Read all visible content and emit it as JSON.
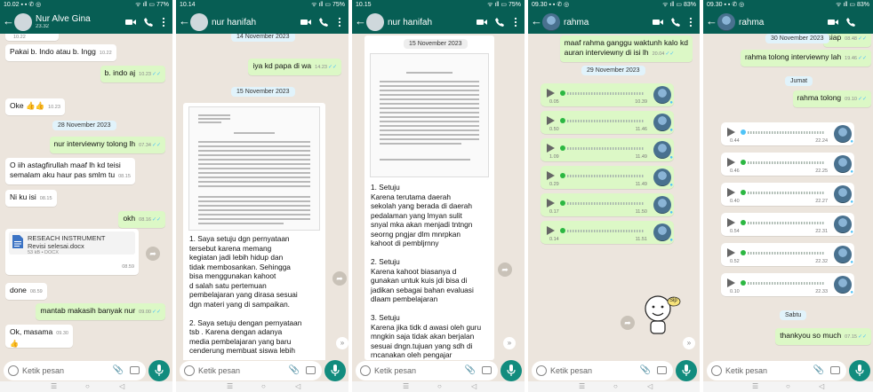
{
  "status_bars": [
    {
      "left": "10.02 ▪ ▪ ✆ ◎",
      "right": "ᯤ ıll ▭ 77%"
    },
    {
      "left": "10.14",
      "right": "ᯤ ıll ▭ 75%"
    },
    {
      "left": "10.15",
      "right": "ᯤ ıll ▭ 75%"
    },
    {
      "left": "09.30 ▪ ▪ ✆ ◎",
      "right": "ᯤ ıll ▭ 83%"
    },
    {
      "left": "09.30 ▪ ▪ ✆ ◎",
      "right": "ᯤ ıll ▭ 83%"
    }
  ],
  "contacts": [
    {
      "name": "Nur Alve Gina",
      "sub": "23.32"
    },
    {
      "name": "nur hanifah",
      "sub": ""
    },
    {
      "name": "nur hanifah",
      "sub": ""
    },
    {
      "name": "rahma",
      "sub": ""
    },
    {
      "name": "rahma",
      "sub": ""
    }
  ],
  "input_placeholder": "Ketik pesan",
  "panel1": {
    "msgs": [
      {
        "text": "Pakai b. Indo atau b. Ingg",
        "time": "10.22"
      },
      {
        "text": "b. indo aj",
        "time": "10.23"
      },
      {
        "text": "Oke 👍👍",
        "time": "10.23"
      },
      {
        "date": "28 November 2023"
      },
      {
        "text": "nur interviewny tolong lh",
        "time": "07.34"
      },
      {
        "text": "O iih astagfirullah maaf lh kd teisi",
        "text2": "semalam aku haur pas smlm tu",
        "time": "08.15"
      },
      {
        "text": "Ni ku isi",
        "time": "08.15"
      },
      {
        "text": "okh",
        "time": "08.16"
      },
      {
        "file_title": "RESEACH INSTRUMENT",
        "file_name": "Revisi selesai.docx",
        "file_meta": "53 kB • DOCX",
        "time": "08.59"
      },
      {
        "text": "done",
        "time": "08.59"
      },
      {
        "text": "mantab makasih banyak nur",
        "time": "09.00"
      },
      {
        "text": "Ok, masama",
        "time": "09.30"
      }
    ]
  },
  "panel2": {
    "msgs": [
      {
        "date": "14 November 2023"
      },
      {
        "text": "iya kd papa di wa",
        "time": "14.23"
      },
      {
        "date": "15 November 2023"
      }
    ],
    "doc_text": "1. Saya setuju dgn pernyataan\ntersebut karena memang\nkegiatan jadi lebih hidup dan\ntidak membosankan. Sehingga\nbisa menggunakan kahoot\nd salah satu pertemuan\npembelajaran yang dirasa sesuai\ndgn materi yang di sampaikan.\n\n2. Saya setuju dengan pernyataan\ntsb . Karena dengan adanya\nmedia pembelajaran yang baru\ncenderung membuat siswa lebih"
  },
  "panel3": {
    "msgs": [
      {
        "date": "15 November 2023"
      }
    ],
    "doc_text": "1. Setuju\nKarena terutama daerah\nsekolah yang berada di daerah\npedalaman yang lmyan sulit\nsnyal mka akan menjadi tntngn\nseorng pngjar dlm mnrpkan\nkahoot di pembljrnny\n\n2. Setuju\nKarena kahoot biasanya d\ngunakan untuk kuis jdi bisa di\njadikan sebagai bahan evaluasi\ndlaam pembelajaran\n\n3. Setuju\nKarena jika tidk d awasi oleh guru\nmngkin saja tidak akan berjalan\nsesuai dngn.tujuan yang sdh di\nrncanakan oleh pengajar"
  },
  "panel4": {
    "msgs": [
      {
        "text": "maaf rahma ganggu waktunh kalo kd",
        "text2": "auran interviewny di isi lh",
        "time": "20.04"
      },
      {
        "date": "29 November 2023"
      }
    ],
    "audios": [
      {
        "duration": "0.05",
        "time": "10.39"
      },
      {
        "duration": "0.50",
        "time": "11.46"
      },
      {
        "duration": "1.09",
        "time": "11.49"
      },
      {
        "duration": "0.29",
        "time": "11.49"
      },
      {
        "duration": "0.17",
        "time": "11.50"
      },
      {
        "duration": "0.14",
        "time": "11.51"
      }
    ],
    "sticker": "Sip"
  },
  "panel5": {
    "msgs": [
      {
        "text": "siap",
        "time": "08.48"
      },
      {
        "date": "30 November 2023"
      },
      {
        "text": "rahma tolong interviewny lah",
        "time": "19.46"
      },
      {
        "date": "Jumat"
      },
      {
        "text": "rahma tolong",
        "time": "09.10"
      },
      {
        "date": "Sabtu"
      },
      {
        "text": "thankyou so much",
        "time": "07.15"
      }
    ],
    "audios": [
      {
        "duration": "0.44",
        "time": "22.24"
      },
      {
        "duration": "0.46",
        "time": "22.25"
      },
      {
        "duration": "0.40",
        "time": "22.27"
      },
      {
        "duration": "0.54",
        "time": "22.31"
      },
      {
        "duration": "0.52",
        "time": "22.32"
      },
      {
        "duration": "0.10",
        "time": "22.33"
      }
    ]
  },
  "colors": {
    "header": "#075E54",
    "wallpaper": "#ECE5DD",
    "outgoing": "#DCF8C6",
    "incoming": "#FFFFFF",
    "accent": "#128C7E",
    "read_tick": "#4FC3F7"
  }
}
